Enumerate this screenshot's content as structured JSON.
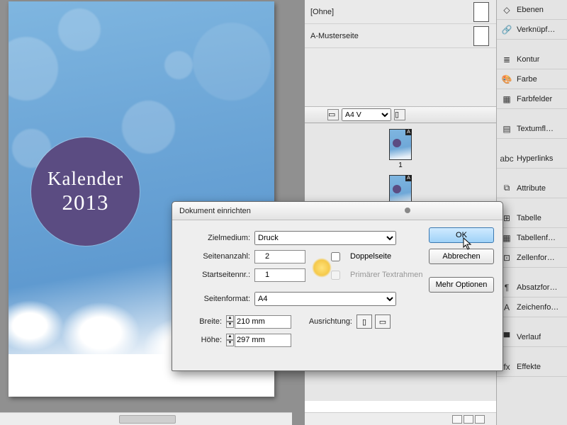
{
  "canvas": {
    "title_line1": "Kalender",
    "title_line2": "2013"
  },
  "pages_panel": {
    "masters": [
      {
        "label": "[Ohne]"
      },
      {
        "label": "A-Musterseite"
      }
    ],
    "size_preset": "A4 V",
    "page1_num": "1"
  },
  "toolbox": {
    "items": [
      {
        "icon": "◇",
        "label": "Ebenen",
        "name": "tool-ebenen"
      },
      {
        "icon": "🔗",
        "label": "Verknüpf…",
        "name": "tool-verknuepf"
      },
      {
        "sep": true
      },
      {
        "icon": "≣",
        "label": "Kontur",
        "name": "tool-kontur"
      },
      {
        "icon": "🎨",
        "label": "Farbe",
        "name": "tool-farbe"
      },
      {
        "icon": "▦",
        "label": "Farbfelder",
        "name": "tool-farbfelder"
      },
      {
        "sep": true
      },
      {
        "icon": "▤",
        "label": "Textumfl…",
        "name": "tool-textumfluss"
      },
      {
        "sep": true
      },
      {
        "icon": "abc",
        "label": "Hyperlinks",
        "name": "tool-hyperlinks"
      },
      {
        "sep": true
      },
      {
        "icon": "⧉",
        "label": "Attribute",
        "name": "tool-attribute"
      },
      {
        "sep": true
      },
      {
        "icon": "⊞",
        "label": "Tabelle",
        "name": "tool-tabelle"
      },
      {
        "icon": "▦",
        "label": "Tabellenf…",
        "name": "tool-tabellenf"
      },
      {
        "icon": "⊡",
        "label": "Zellenfor…",
        "name": "tool-zellenfor"
      },
      {
        "sep": true
      },
      {
        "icon": "¶",
        "label": "Absatzfor…",
        "name": "tool-absatzfor"
      },
      {
        "icon": "A",
        "label": "Zeichenfo…",
        "name": "tool-zeichenfo"
      },
      {
        "sep": true
      },
      {
        "icon": "▀",
        "label": "Verlauf",
        "name": "tool-verlauf"
      },
      {
        "sep": true
      },
      {
        "icon": "fx",
        "label": "Effekte",
        "name": "tool-effekte"
      }
    ]
  },
  "dialog": {
    "title": "Dokument einrichten",
    "fields": {
      "zielmedium_label": "Zielmedium:",
      "zielmedium_value": "Druck",
      "seitenanzahl_label": "Seitenanzahl:",
      "seitenanzahl_value": "2",
      "startseite_label": "Startseitennr.:",
      "startseite_value": "1",
      "doppelseite_label": "Doppelseite",
      "primaer_label": "Primärer Textrahmen",
      "seitenformat_label": "Seitenformat:",
      "seitenformat_value": "A4",
      "breite_label": "Breite:",
      "breite_value": "210 mm",
      "hoehe_label": "Höhe:",
      "hoehe_value": "297 mm",
      "ausrichtung_label": "Ausrichtung:"
    },
    "buttons": {
      "ok": "OK",
      "cancel": "Abbrechen",
      "more": "Mehr Optionen"
    }
  }
}
